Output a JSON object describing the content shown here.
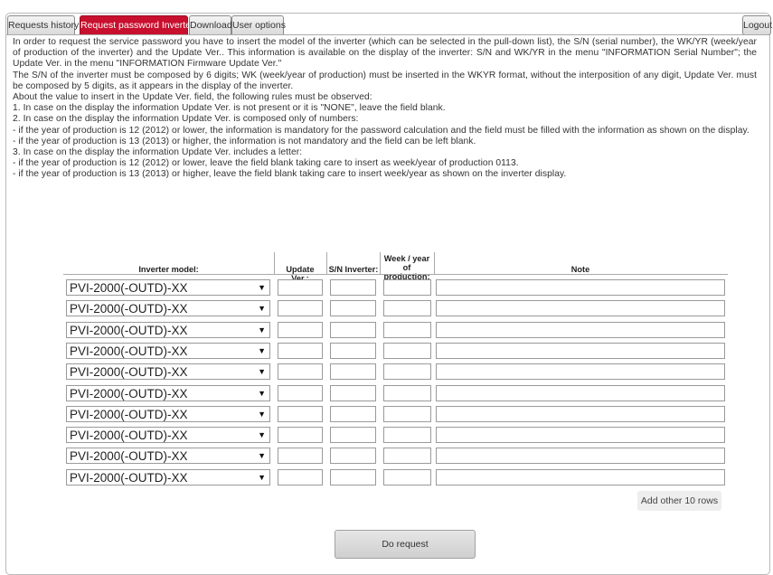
{
  "tabs": [
    {
      "label": "Requests history"
    },
    {
      "label": "Request password Inverter"
    },
    {
      "label": "Download"
    },
    {
      "label": "User options"
    }
  ],
  "logout_label": "Logout",
  "instructions": [
    "In order to request the service password you have to insert the model of the inverter (which can be selected in the pull-down list), the S/N (serial number), the WK/YR (week/year of production of the inverter) and the Update Ver.. This information is available on the display of the inverter: S/N and WK/YR in the menu \"INFORMATION  Serial Number\"; the Update Ver. in the menu \"INFORMATION  Firmware  Update Ver.\"",
    "The S/N of the inverter must be composed by 6 digits; WK (week/year of production) must be inserted in the WKYR format, without the interposition of any digit, Update Ver. must be composed by 5 digits, as it appears in the display of the inverter.",
    "About the value to insert in the Update Ver. field, the following rules must be observed:",
    "1. In case on the display the information Update Ver. is not present or it is \"NONE\", leave the field blank.",
    "2. In case on the display the information Update Ver. is composed only of numbers:",
    "- if the year of production is 12 (2012) or lower, the information is mandatory for the password calculation and the field must be filled with the information as shown on the display.",
    "- if the year of production is 13 (2013) or higher, the information is not mandatory and the field can be left blank.",
    "3. In case on the display the information Update Ver. includes a letter:",
    "- if the year of production is 12 (2012) or lower, leave the field blank taking care to insert as week/year of production 0113.",
    "- if the year of production is 13 (2013) or higher, leave the field blank taking care to insert week/year as shown on the inverter display."
  ],
  "table": {
    "headers": {
      "model": "Inverter model:",
      "update": "Update Ver.:",
      "sn": "S/N Inverter:",
      "week_line1": "Week / year",
      "week_line2": "of production:",
      "note": "Note"
    },
    "rows": [
      {
        "model": "PVI-2000(-OUTD)-XX"
      },
      {
        "model": "PVI-2000(-OUTD)-XX"
      },
      {
        "model": "PVI-2000(-OUTD)-XX"
      },
      {
        "model": "PVI-2000(-OUTD)-XX"
      },
      {
        "model": "PVI-2000(-OUTD)-XX"
      },
      {
        "model": "PVI-2000(-OUTD)-XX"
      },
      {
        "model": "PVI-2000(-OUTD)-XX"
      },
      {
        "model": "PVI-2000(-OUTD)-XX"
      },
      {
        "model": "PVI-2000(-OUTD)-XX"
      },
      {
        "model": "PVI-2000(-OUTD)-XX"
      }
    ]
  },
  "add_rows_label": "Add other 10 rows",
  "do_request_label": "Do request",
  "colors": {
    "active_tab": "#c8102e",
    "border": "#9a9a9a"
  }
}
